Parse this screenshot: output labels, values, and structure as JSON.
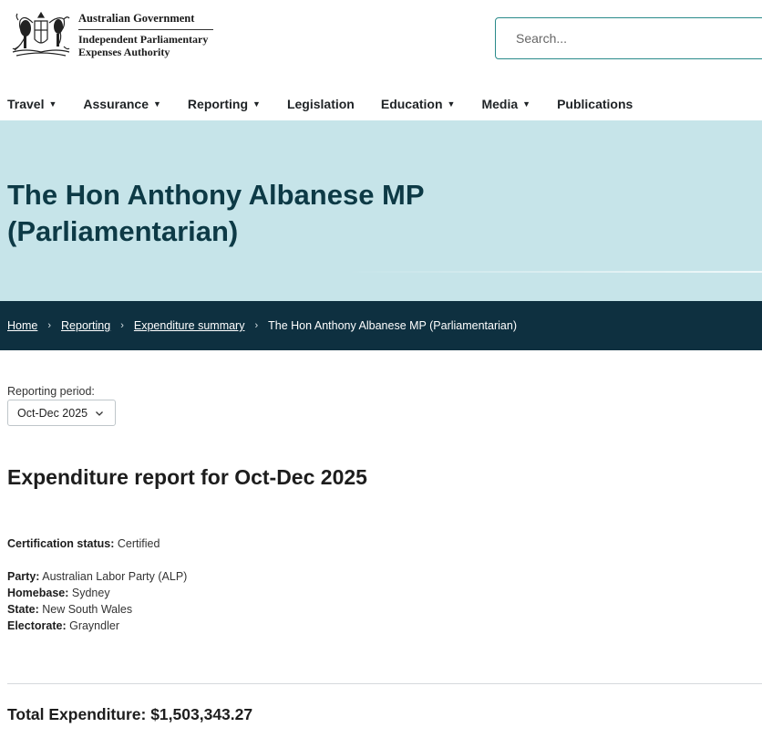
{
  "header": {
    "gov_name": "Australian Government",
    "agency_line1": "Independent Parliamentary",
    "agency_line2": "Expenses Authority",
    "search_placeholder": "Search..."
  },
  "nav": {
    "items": [
      {
        "label": "Travel",
        "has_dropdown": true
      },
      {
        "label": "Assurance",
        "has_dropdown": true
      },
      {
        "label": "Reporting",
        "has_dropdown": true
      },
      {
        "label": "Legislation",
        "has_dropdown": false
      },
      {
        "label": "Education",
        "has_dropdown": true
      },
      {
        "label": "Media",
        "has_dropdown": true
      },
      {
        "label": "Publications",
        "has_dropdown": false
      }
    ],
    "caret_glyph": "▼"
  },
  "hero": {
    "title_line1": "The Hon Anthony Albanese MP",
    "title_line2": "(Parliamentarian)"
  },
  "breadcrumb": {
    "home": "Home",
    "reporting": "Reporting",
    "expenditure_summary": "Expenditure summary",
    "current": "The Hon Anthony Albanese MP (Parliamentarian)",
    "separator": "›"
  },
  "report": {
    "period_label": "Reporting period:",
    "period_value": "Oct-Dec 2025",
    "title": "Expenditure report for Oct-Dec 2025",
    "certification_label": "Certification status:",
    "certification_value": "Certified",
    "party_label": "Party:",
    "party_value": "Australian Labor Party (ALP)",
    "homebase_label": "Homebase:",
    "homebase_value": "Sydney",
    "state_label": "State:",
    "state_value": "New South Wales",
    "electorate_label": "Electorate:",
    "electorate_value": "Grayndler",
    "total_label": "Total Expenditure:",
    "total_value": "$1,503,343.27"
  },
  "colors": {
    "hero_bg": "#c6e4e9",
    "hero_text": "#0d3a46",
    "breadcrumb_bg": "#0e3040",
    "search_border": "#2a8a8a"
  }
}
